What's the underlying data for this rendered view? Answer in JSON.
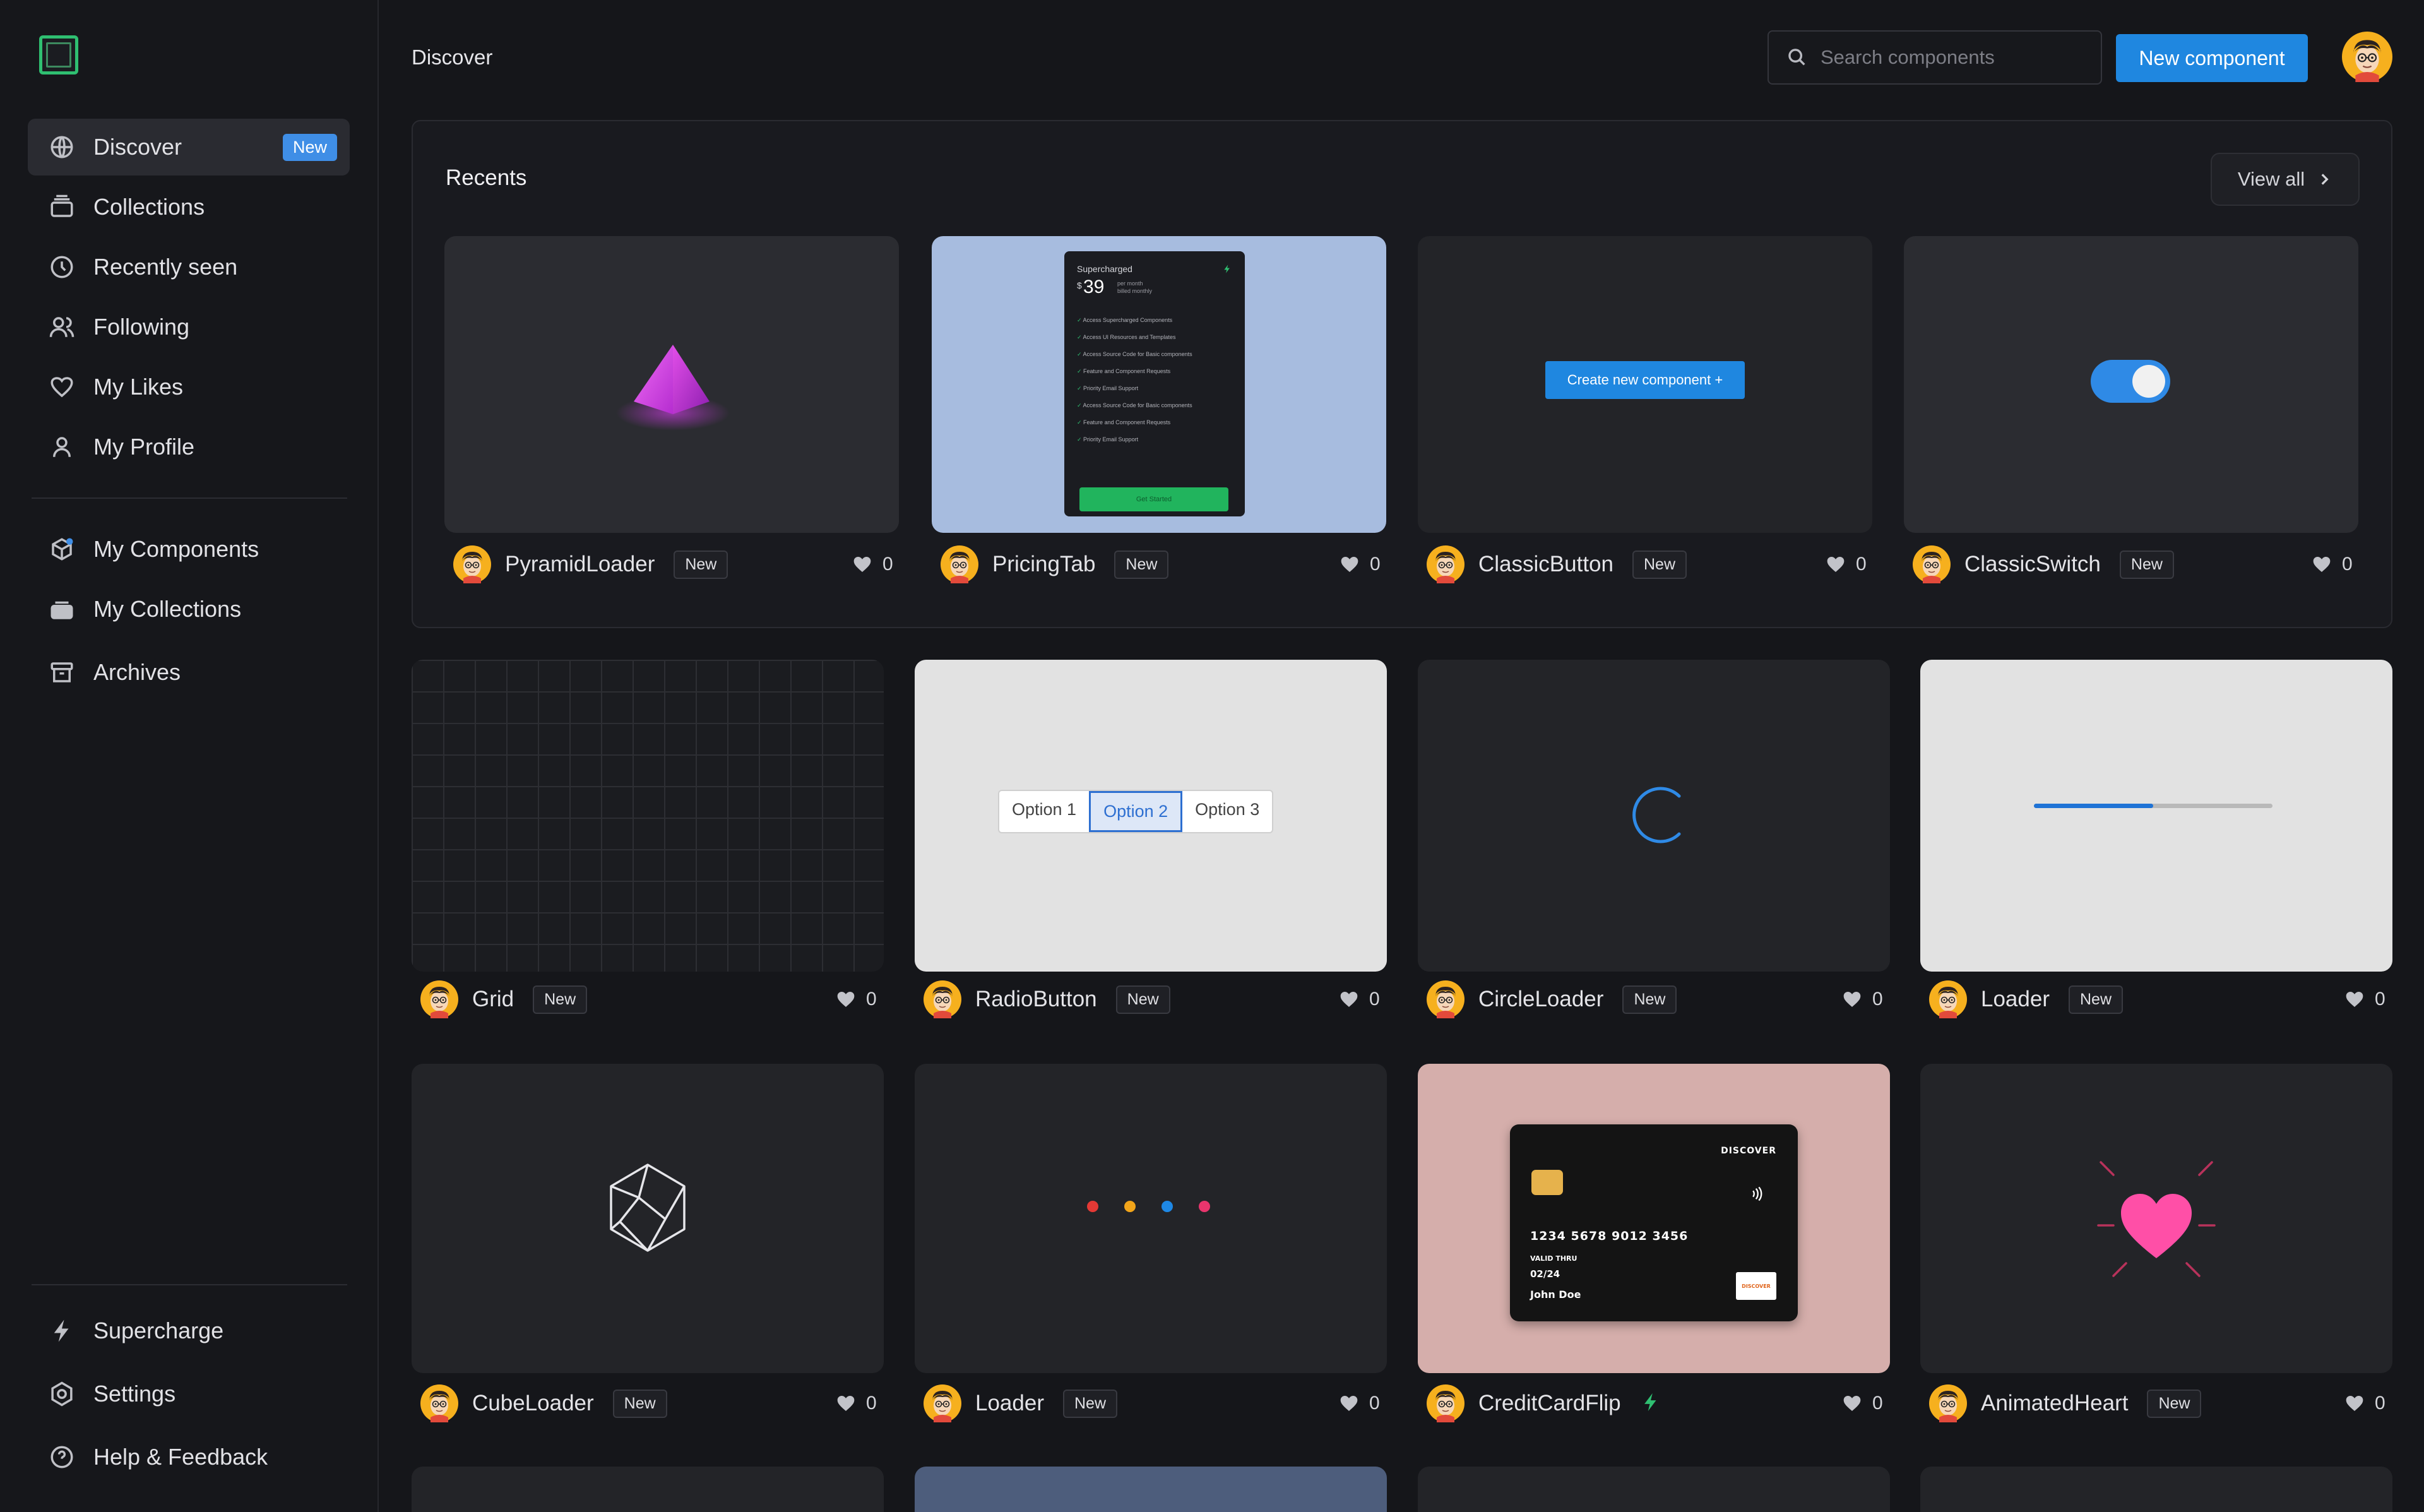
{
  "header": {
    "title": "Discover",
    "search_placeholder": "Search components",
    "new_button": "New component"
  },
  "sidebar": {
    "items": [
      {
        "label": "Discover",
        "icon": "globe-icon",
        "badge": "New"
      },
      {
        "label": "Collections",
        "icon": "layers-icon"
      },
      {
        "label": "Recently seen",
        "icon": "clock-icon"
      },
      {
        "label": "Following",
        "icon": "users-icon"
      },
      {
        "label": "My Likes",
        "icon": "heart-icon"
      },
      {
        "label": "My Profile",
        "icon": "user-icon"
      },
      {
        "label": "My Components",
        "icon": "box-icon"
      },
      {
        "label": "My Collections",
        "icon": "folder-stack-icon"
      },
      {
        "label": "Archives",
        "icon": "archive-icon"
      },
      {
        "label": "Supercharge",
        "icon": "bolt-icon"
      },
      {
        "label": "Settings",
        "icon": "settings-icon"
      },
      {
        "label": "Help & Feedback",
        "icon": "help-icon"
      }
    ]
  },
  "recents": {
    "title": "Recents",
    "view_all": "View all",
    "cards": [
      {
        "name": "PyramidLoader",
        "badge": "New",
        "likes": "0"
      },
      {
        "name": "PricingTab",
        "badge": "New",
        "likes": "0"
      },
      {
        "name": "ClassicButton",
        "badge": "New",
        "likes": "0"
      },
      {
        "name": "ClassicSwitch",
        "badge": "New",
        "likes": "0"
      }
    ]
  },
  "previews": {
    "pricing": {
      "title": "Supercharged",
      "currency": "$",
      "price": "39",
      "per": "per month",
      "billed": "billed monthly",
      "features": [
        "Access Supercharged Components",
        "Access UI Resources and Templates",
        "Access Source Code for Basic components",
        "Feature and Component Requests",
        "Priority Email Support",
        "Access Source Code for Basic components",
        "Feature and Component Requests",
        "Priority Email Support"
      ],
      "cta": "Get Started"
    },
    "classic_button": "Create new component +",
    "radio_options": [
      "Option 1",
      "Option 2",
      "Option 3"
    ],
    "radio_selected_index": 1,
    "loader_progress": 0.5,
    "credit_card": {
      "brand": "DISCOVER",
      "number": "1234 5678 9012 3456",
      "valid_label": "VALID THRU",
      "expiry": "02/24",
      "holder": "John Doe",
      "logo": "DISCOVER"
    },
    "dot_colors": [
      "#e53935",
      "#f2a51a",
      "#1e88e5",
      "#e8356d"
    ]
  },
  "grid": {
    "cards": [
      {
        "name": "Grid",
        "badge": "New",
        "likes": "0"
      },
      {
        "name": "RadioButton",
        "badge": "New",
        "likes": "0"
      },
      {
        "name": "CircleLoader",
        "badge": "New",
        "likes": "0"
      },
      {
        "name": "Loader",
        "badge": "New",
        "likes": "0"
      },
      {
        "name": "CubeLoader",
        "badge": "New",
        "likes": "0"
      },
      {
        "name": "Loader",
        "badge": "New",
        "likes": "0"
      },
      {
        "name": "CreditCardFlip",
        "badge": "",
        "likes": "0",
        "icon": "bolt-icon"
      },
      {
        "name": "AnimatedHeart",
        "badge": "New",
        "likes": "0"
      }
    ]
  },
  "colors": {
    "accent": "#1f87e0",
    "badge_blue": "#3f8ee6",
    "logo_green": "#2fbf71"
  }
}
